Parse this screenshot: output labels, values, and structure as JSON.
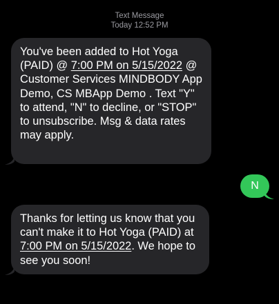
{
  "thread_header": {
    "label": "Text Message",
    "timestamp": "Today 12:52 PM"
  },
  "messages": [
    {
      "direction": "incoming",
      "text_before": "You've been added to Hot Yoga (PAID) @ ",
      "link": "7:00 PM on 5/15/2022",
      "text_after": " @ Customer Services MINDBODY App Demo, CS MBApp Demo . Text \"Y\" to attend, \"N\" to decline, or \"STOP\" to unsubscribe. Msg & data rates may apply."
    },
    {
      "direction": "outgoing",
      "text": "N"
    },
    {
      "direction": "incoming",
      "text_before": "Thanks for letting us know that you can't make it to Hot Yoga (PAID) at ",
      "link": "7:00 PM on 5/15/2022",
      "text_after": ". We hope to see you soon!"
    }
  ],
  "colors": {
    "background": "#000000",
    "incoming_bubble": "#262629",
    "outgoing_bubble": "#33c759",
    "header_text": "#9a9aa0"
  }
}
